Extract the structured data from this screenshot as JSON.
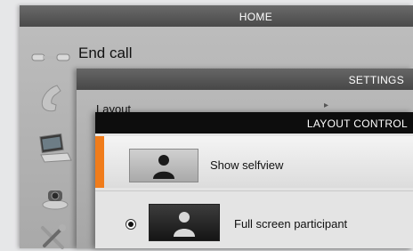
{
  "home": {
    "title": "HOME",
    "end_call_label": "End call",
    "icons": [
      "end-call-icon",
      "phone-icon",
      "laptop-icon",
      "webcam-icon",
      "tools-icon"
    ]
  },
  "settings": {
    "title": "SETTINGS",
    "items": [
      {
        "label": "Layout",
        "icon": "chevron-right-icon"
      }
    ]
  },
  "layout_control": {
    "title": "LAYOUT CONTROL",
    "accent_color": "#f07c1b",
    "options": [
      {
        "label": "Show selfview",
        "selected": true
      },
      {
        "label": "Full screen participant",
        "radio_checked": true
      }
    ]
  }
}
